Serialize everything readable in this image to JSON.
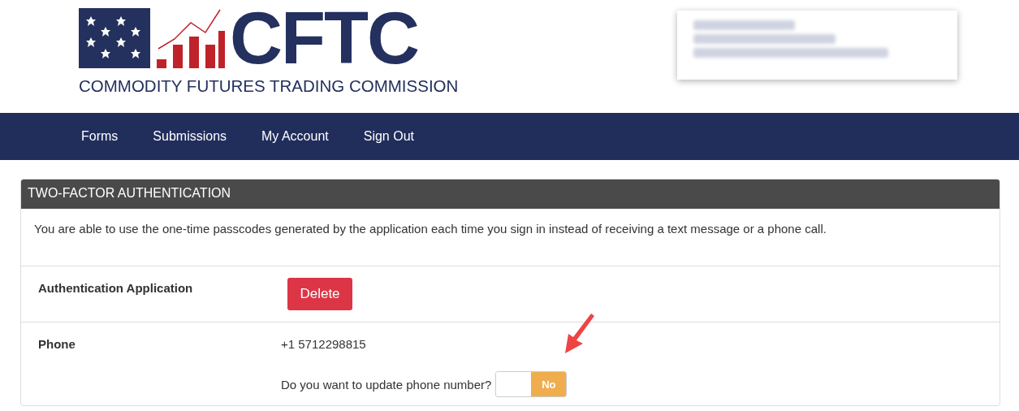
{
  "logo": {
    "acronym": "CFTC",
    "tagline": "COMMODITY FUTURES TRADING COMMISSION"
  },
  "nav": [
    {
      "label": "Forms"
    },
    {
      "label": "Submissions"
    },
    {
      "label": "My Account"
    },
    {
      "label": "Sign Out"
    }
  ],
  "panel": {
    "title": "TWO-FACTOR AUTHENTICATION",
    "description": "You are able to use the one-time passcodes generated by the application each time you sign in instead of receiving a text message or a phone call.",
    "rows": [
      {
        "kind": "button",
        "label": "Authentication Application",
        "button": "Delete"
      },
      {
        "kind": "phone",
        "label": "Phone",
        "value": "+1 5712298815",
        "question": "Do you want to update phone number?",
        "toggle": {
          "on": false,
          "label": "No"
        }
      }
    ]
  }
}
